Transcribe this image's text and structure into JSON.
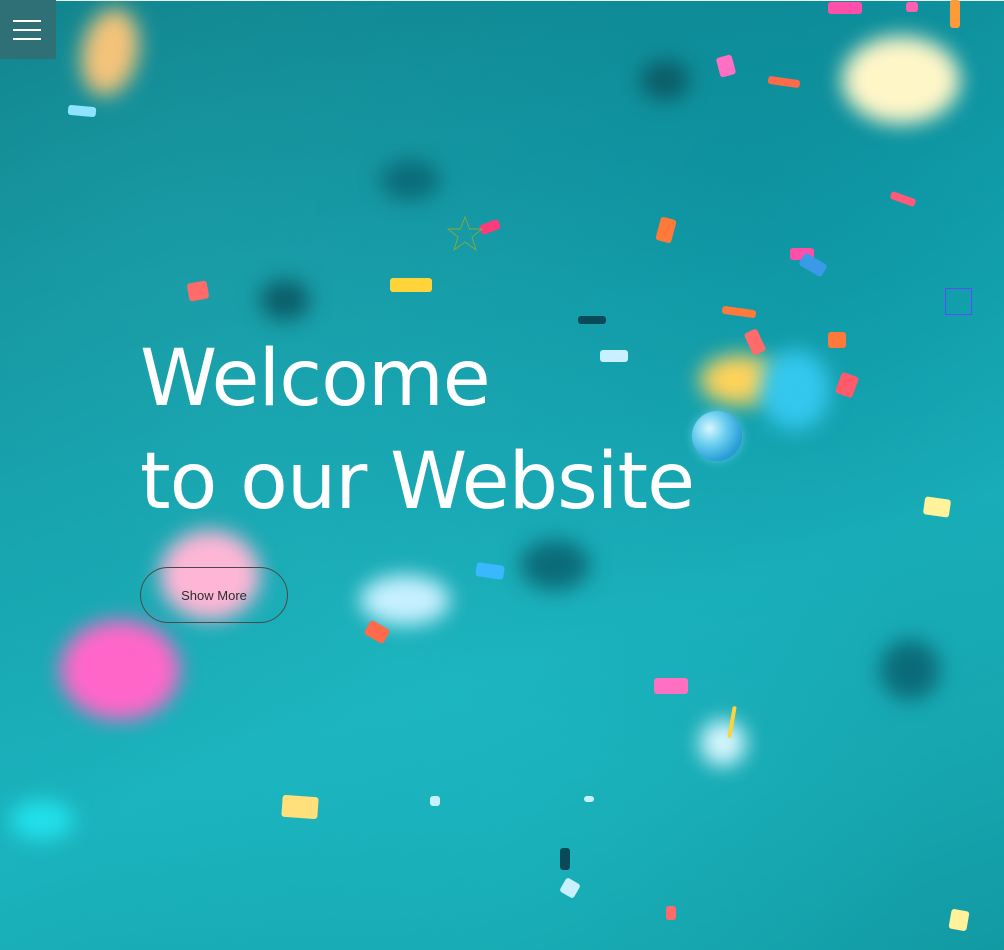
{
  "hero": {
    "headline_line1": "Welcome",
    "headline_line2": "to our Website",
    "cta_label": "Show More",
    "background_color": "#14a3ae"
  },
  "icons": {
    "menu": "hamburger-menu-icon",
    "star": "star-outline-icon",
    "square": "square-outline-icon",
    "bubble": "bubble-icon"
  },
  "colors": {
    "menu_bg": "#2f6f76",
    "headline": "#ffffff",
    "cta_border": "#4a4a4a",
    "star_stroke": "#8aa83a",
    "square_stroke": "#5a4bff"
  }
}
